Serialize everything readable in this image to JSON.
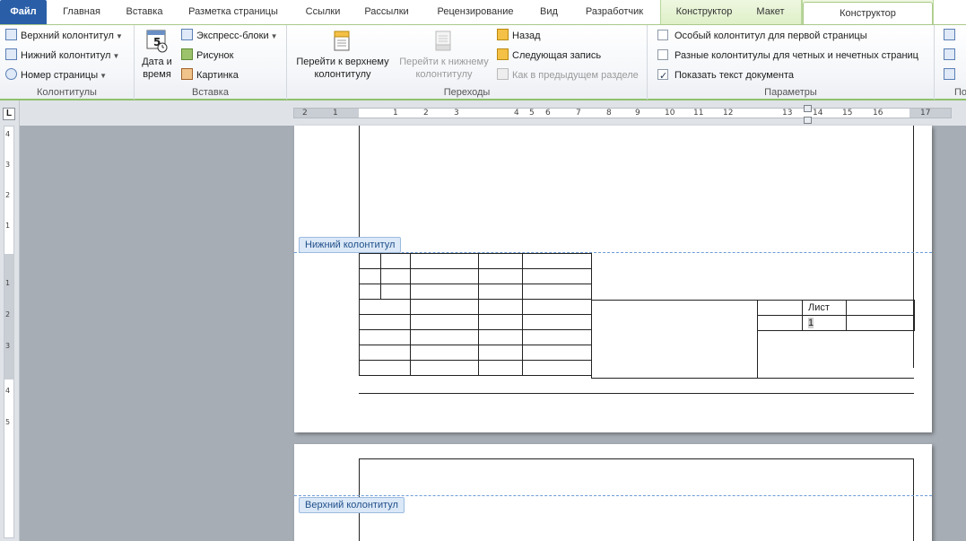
{
  "tabs": {
    "file": "Файл",
    "items": [
      "Главная",
      "Вставка",
      "Разметка страницы",
      "Ссылки",
      "Рассылки",
      "Рецензирование",
      "Вид",
      "Разработчик"
    ],
    "context_table": [
      "Конструктор",
      "Макет"
    ],
    "context_hf": "Конструктор"
  },
  "ribbon": {
    "headers_footers": {
      "header": "Верхний колонтитул",
      "footer": "Нижний колонтитул",
      "page_number": "Номер страницы",
      "label": "Колонтитулы"
    },
    "insert": {
      "date_time_line1": "Дата и",
      "date_time_line2": "время",
      "quick_parts": "Экспресс-блоки",
      "picture": "Рисунок",
      "clipart": "Картинка",
      "label": "Вставка"
    },
    "navigation": {
      "goto_header_line1": "Перейти к верхнему",
      "goto_header_line2": "колонтитулу",
      "goto_footer_line1": "Перейти к нижнему",
      "goto_footer_line2": "колонтитулу",
      "previous": "Назад",
      "next": "Следующая запись",
      "link_previous": "Как в предыдущем разделе",
      "label": "Переходы"
    },
    "options": {
      "different_first": "Особый колонтитул для первой страницы",
      "different_odd_even": "Разные колонтитулы для четных и нечетных страниц",
      "show_doc_text": "Показать текст документа",
      "label": "Параметры",
      "different_first_checked": false,
      "different_odd_even_checked": false,
      "show_doc_text_checked": true
    },
    "position": {
      "label": "По"
    }
  },
  "ruler": {
    "tab_selector": "L",
    "h_numbers": [
      "2",
      "1",
      "1",
      "2",
      "3",
      "4",
      "5",
      "6",
      "7",
      "8",
      "9",
      "10",
      "11",
      "12",
      "13",
      "14",
      "15",
      "16",
      "17"
    ],
    "v_numbers": [
      "4",
      "3",
      "2",
      "1",
      "1",
      "2",
      "3",
      "4",
      "5"
    ]
  },
  "document": {
    "footer_label": "Нижний колонтитул",
    "header_label": "Верхний колонтитул",
    "sheet_label": "Лист",
    "page_number": "1"
  },
  "colors": {
    "file_tab": "#2a5fa8",
    "context_green": "#dff0c8",
    "dash_blue": "#6d9cd6",
    "workspace_gray": "#a7adb5"
  }
}
